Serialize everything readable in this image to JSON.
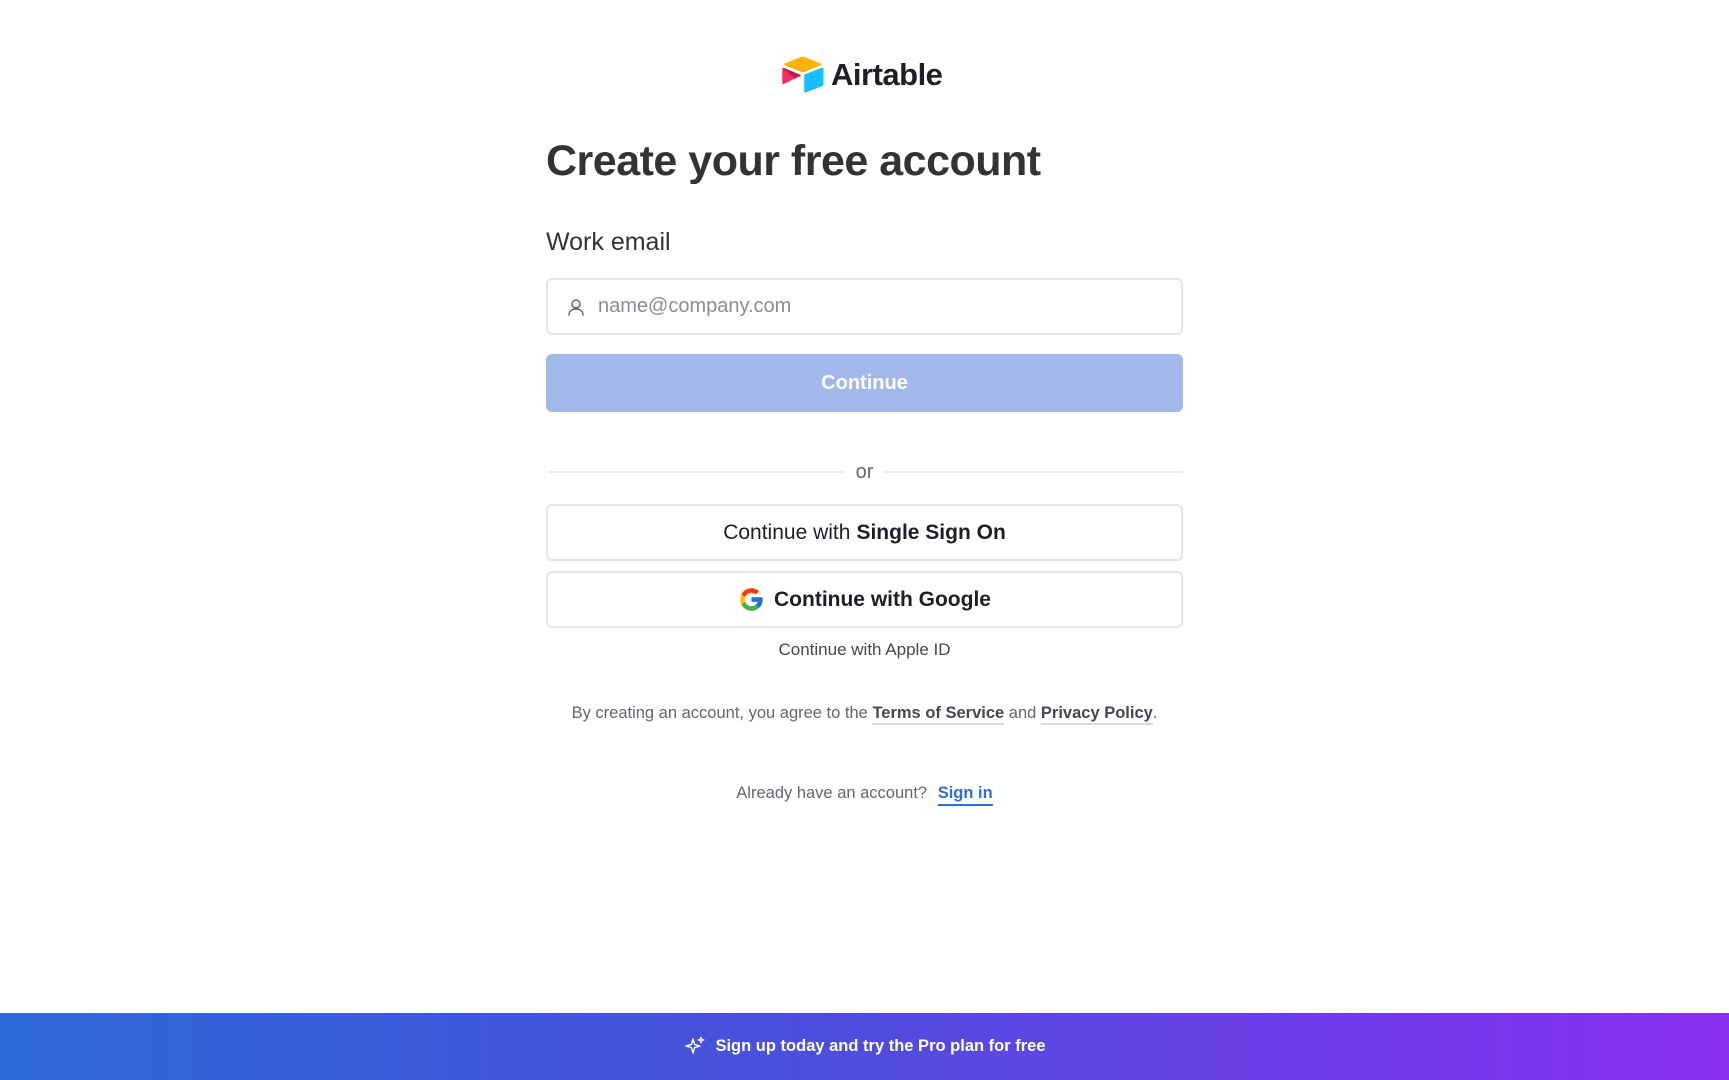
{
  "brand": {
    "name": "Airtable"
  },
  "title": "Create your free account",
  "email": {
    "label": "Work email",
    "placeholder": "name@company.com",
    "value": ""
  },
  "continue_label": "Continue",
  "divider_text": "or",
  "sso": {
    "prefix": "Continue with",
    "bold": "Single Sign On"
  },
  "google": {
    "label": "Continue with Google"
  },
  "apple": {
    "label": "Continue with Apple ID"
  },
  "terms": {
    "prefix": "By creating an account, you agree to the",
    "tos": "Terms of Service",
    "and": "and",
    "privacy": "Privacy Policy",
    "suffix": "."
  },
  "signin": {
    "prompt": "Already have an account?",
    "link": "Sign in"
  },
  "banner": {
    "text": "Sign up today and try the Pro plan for free"
  },
  "colors": {
    "continue_bg": "#a0b8ea",
    "link_blue": "#2d6fd6",
    "banner_start": "#2c6ad6",
    "banner_end": "#8a30f0"
  },
  "icons": {
    "logo": "airtable-logo-icon",
    "email": "user-icon",
    "google": "google-g-icon",
    "banner": "sparkle-icon"
  }
}
